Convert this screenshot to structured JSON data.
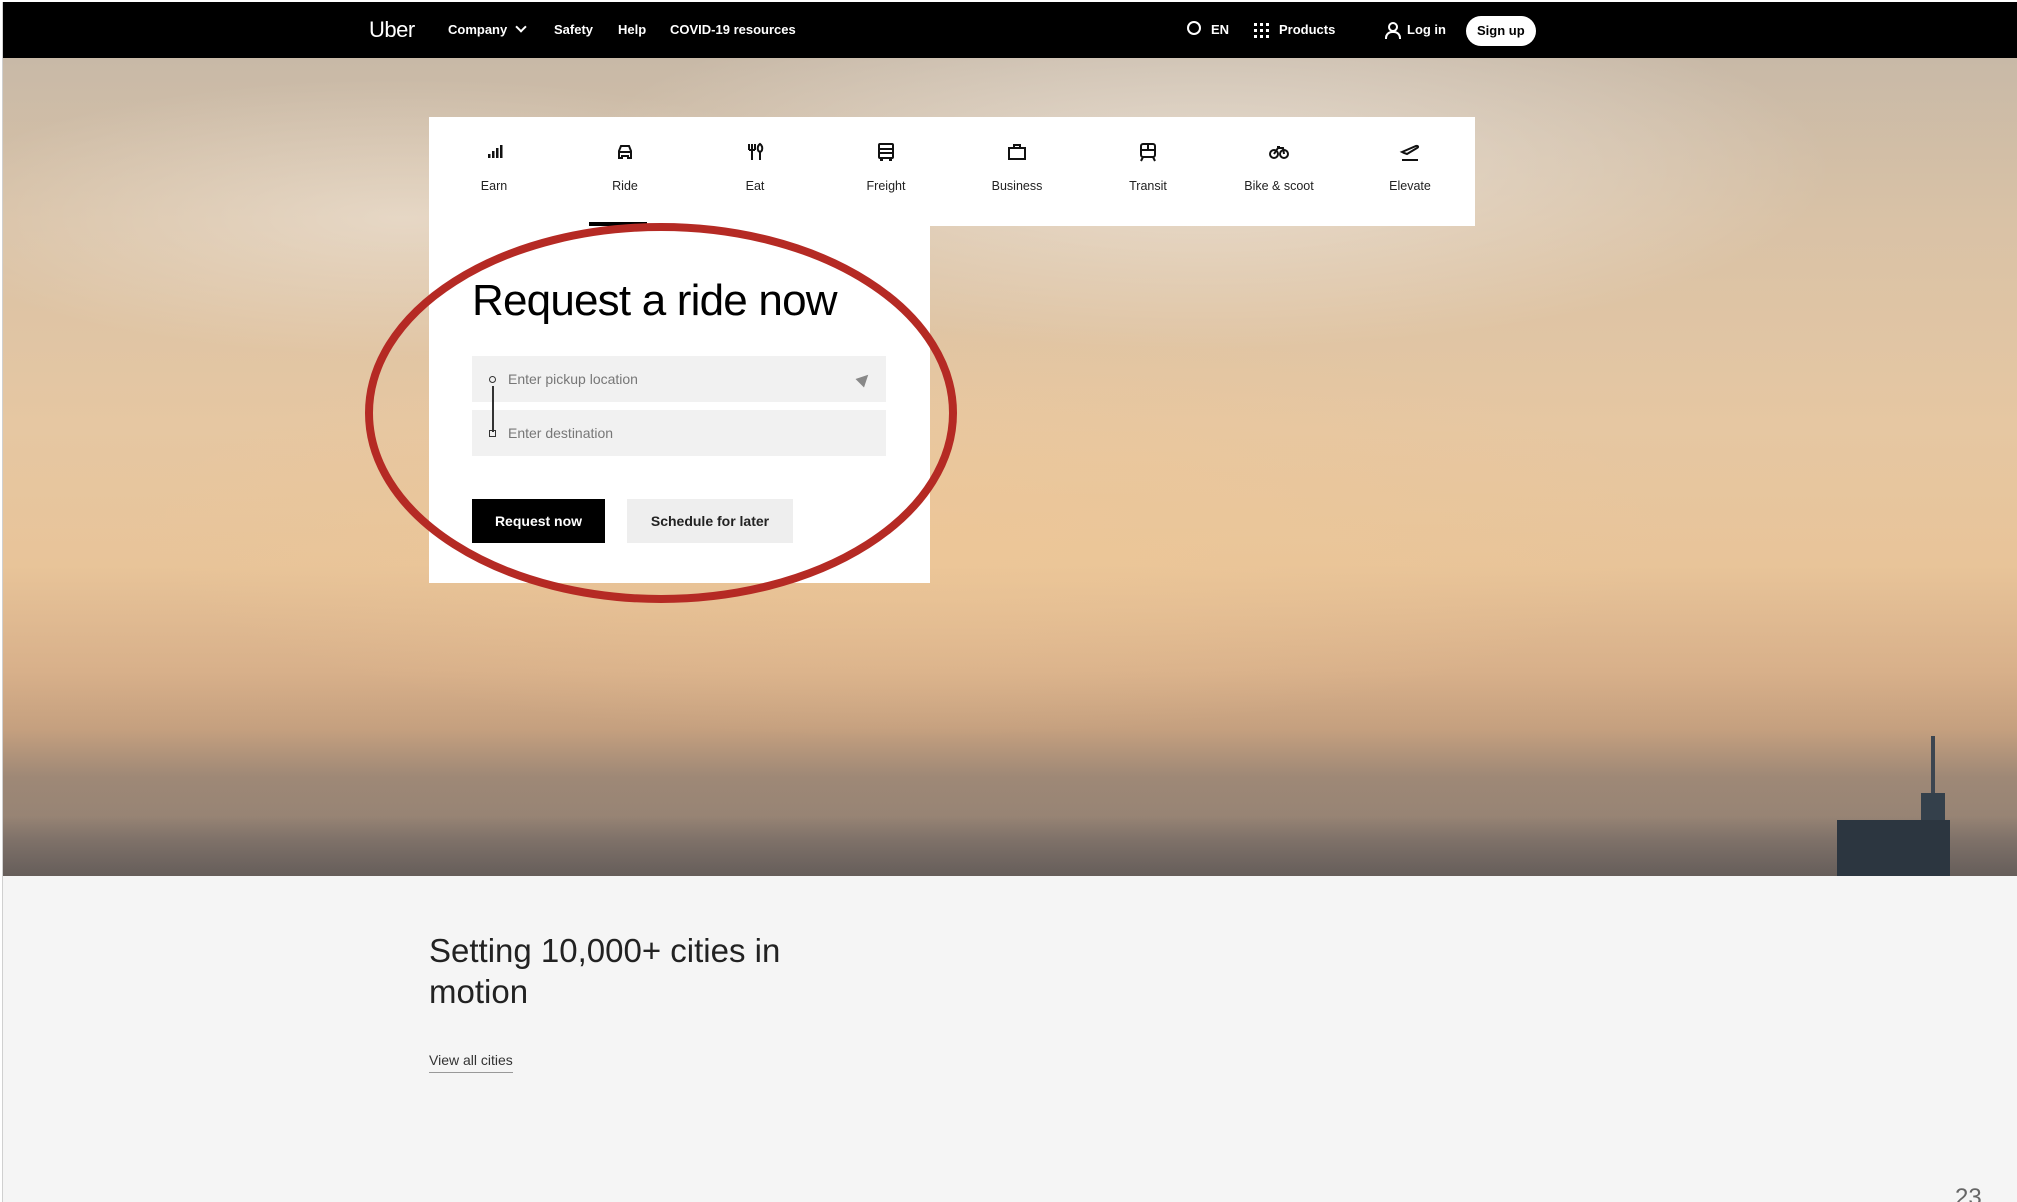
{
  "nav": {
    "logo": "Uber",
    "company": "Company",
    "safety": "Safety",
    "help": "Help",
    "covid": "COVID-19 resources",
    "language": "EN",
    "products": "Products",
    "login": "Log in",
    "signup": "Sign up"
  },
  "categories": [
    {
      "label": "Earn",
      "icon": "bars-icon"
    },
    {
      "label": "Ride",
      "icon": "car-icon"
    },
    {
      "label": "Eat",
      "icon": "fork-knife-icon"
    },
    {
      "label": "Freight",
      "icon": "truck-icon"
    },
    {
      "label": "Business",
      "icon": "briefcase-icon"
    },
    {
      "label": "Transit",
      "icon": "train-icon"
    },
    {
      "label": "Bike & scoot",
      "icon": "bike-icon"
    },
    {
      "label": "Elevate",
      "icon": "plane-icon"
    }
  ],
  "selected_category": "Ride",
  "ride": {
    "title": "Request a ride now",
    "pickup_placeholder": "Enter pickup location",
    "destination_placeholder": "Enter destination",
    "request_button": "Request now",
    "schedule_button": "Schedule for later"
  },
  "lower": {
    "heading": "Setting 10,000+ cities in motion",
    "link": "View all cities"
  },
  "page_number": "23",
  "colors": {
    "nav_bg": "#000000",
    "annotation": "#b52a24",
    "primary_button": "#000000"
  }
}
